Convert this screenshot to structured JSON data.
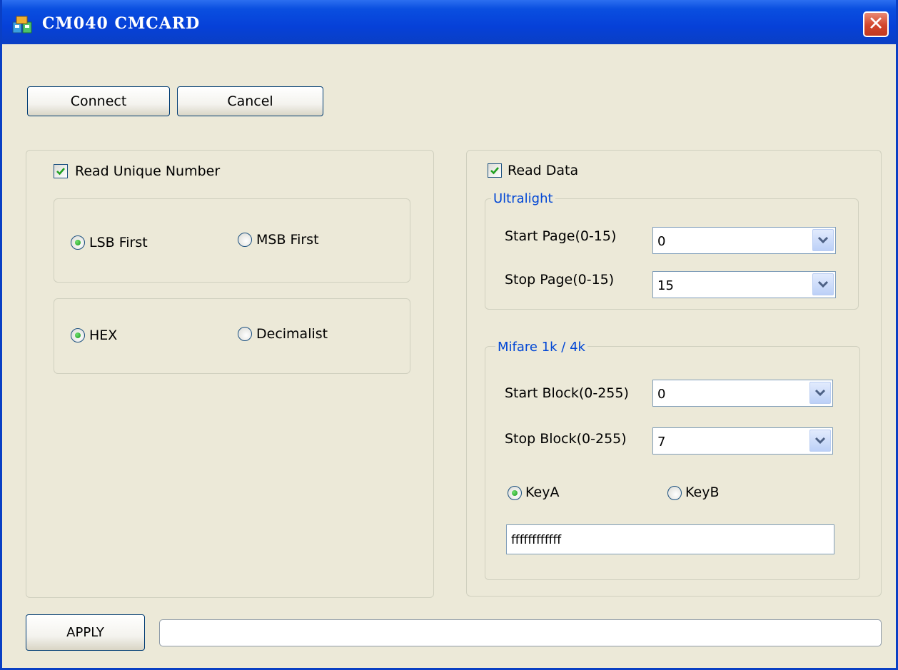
{
  "window": {
    "title": "CM040 CMCARD"
  },
  "toolbar": {
    "connect_label": "Connect",
    "cancel_label": "Cancel"
  },
  "unique_number": {
    "checkbox_label": "Read Unique Number",
    "checked": true,
    "order": {
      "lsb_label": "LSB First",
      "msb_label": "MSB First",
      "selected": "LSB First"
    },
    "format": {
      "hex_label": "HEX",
      "dec_label": "Decimalist",
      "selected": "HEX"
    }
  },
  "read_data": {
    "checkbox_label": "Read Data",
    "checked": true,
    "ultralight": {
      "legend": "Ultralight",
      "start_label": "Start Page(0-15)",
      "start_value": "0",
      "stop_label": "Stop Page(0-15)",
      "stop_value": "15"
    },
    "mifare": {
      "legend": "Mifare 1k / 4k",
      "start_label": "Start Block(0-255)",
      "start_value": "0",
      "stop_label": "Stop Block(0-255)",
      "stop_value": "7",
      "keya_label": "KeyA",
      "keyb_label": "KeyB",
      "selected_key": "KeyA",
      "key_value": "ffffffffffff"
    }
  },
  "footer": {
    "apply_label": "APPLY",
    "status_text": ""
  },
  "icons": {
    "app": "card-reader-icon",
    "close": "close-icon",
    "dropdown": "chevron-down-icon",
    "check": "checkmark-icon"
  },
  "colors": {
    "titlebar": "#0a4fe0",
    "window_bg": "#ece9d8",
    "legend_text": "#0046d5",
    "close_button": "#d2452b"
  }
}
